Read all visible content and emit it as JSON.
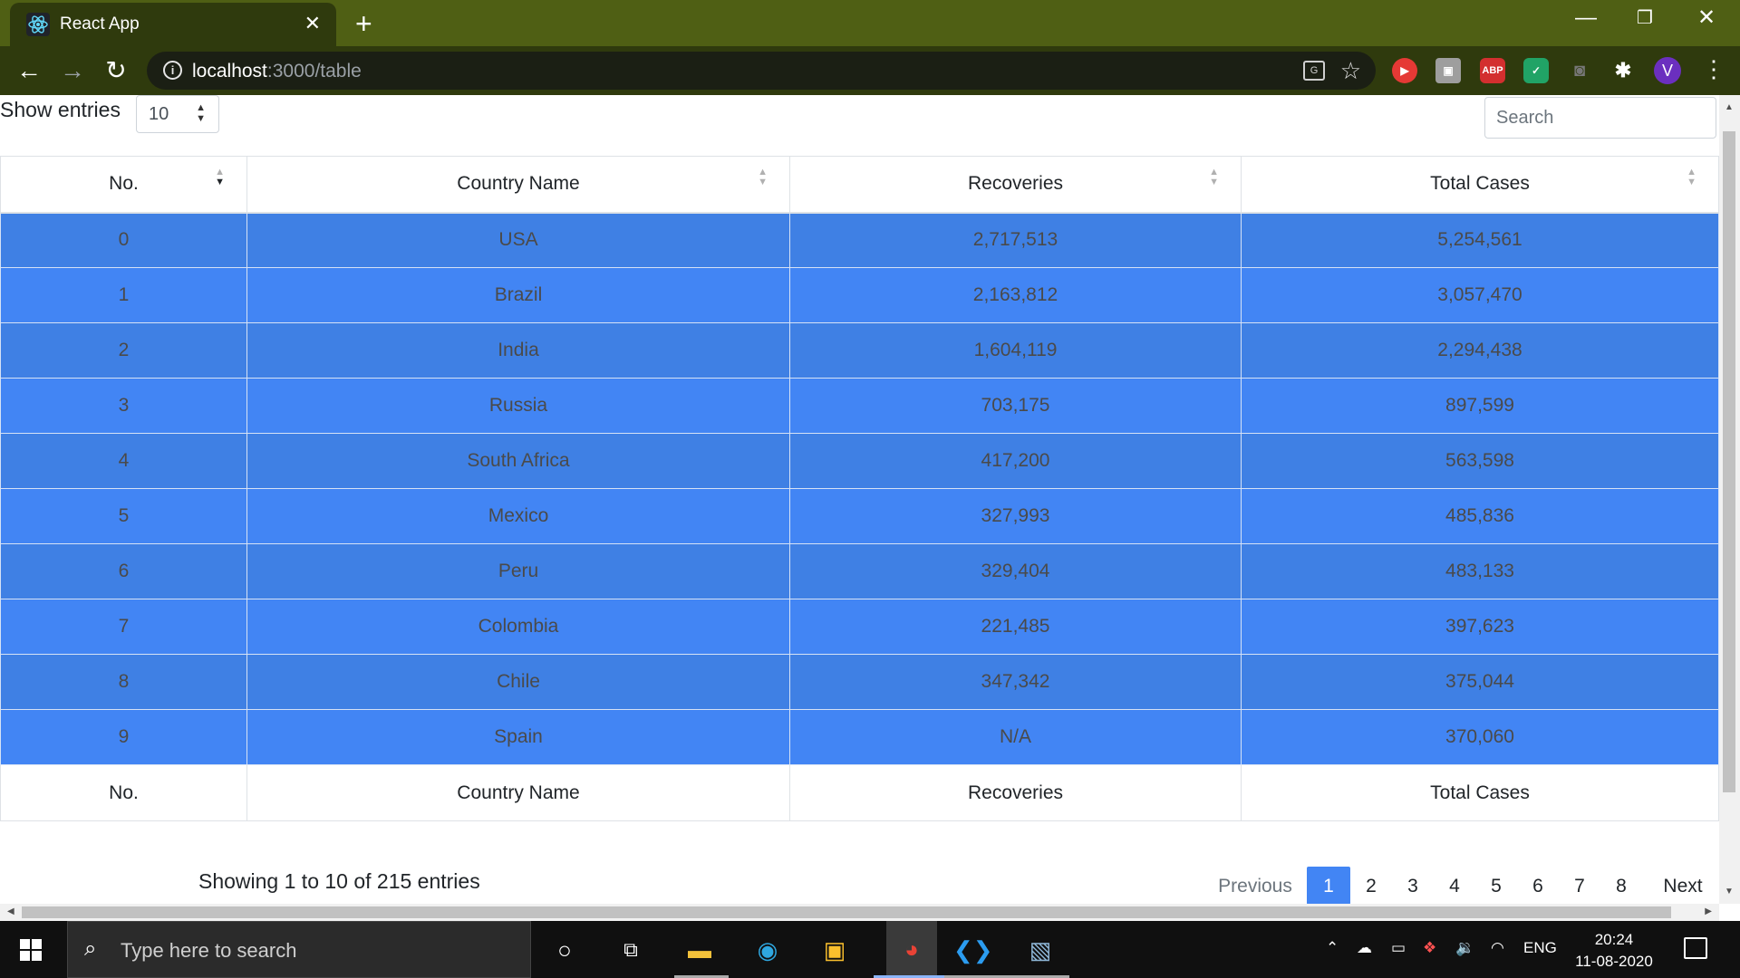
{
  "browser": {
    "tab_title": "React App",
    "url_host": "localhost",
    "url_rest": ":3000/table",
    "extensions": [
      "youtube-ext",
      "ext-grey",
      "ABP",
      "check-ext",
      "camera-ext",
      "puzzle-ext"
    ],
    "abp_label": "ABP",
    "profile_initial": "V"
  },
  "page": {
    "show_entries_label": "Show entries",
    "entries_value": "10",
    "search_placeholder": "Search",
    "columns": [
      "No.",
      "Country Name",
      "Recoveries",
      "Total Cases"
    ],
    "rows": [
      [
        "0",
        "USA",
        "2,717,513",
        "5,254,561"
      ],
      [
        "1",
        "Brazil",
        "2,163,812",
        "3,057,470"
      ],
      [
        "2",
        "India",
        "1,604,119",
        "2,294,438"
      ],
      [
        "3",
        "Russia",
        "703,175",
        "897,599"
      ],
      [
        "4",
        "South Africa",
        "417,200",
        "563,598"
      ],
      [
        "5",
        "Mexico",
        "327,993",
        "485,836"
      ],
      [
        "6",
        "Peru",
        "329,404",
        "483,133"
      ],
      [
        "7",
        "Colombia",
        "221,485",
        "397,623"
      ],
      [
        "8",
        "Chile",
        "347,342",
        "375,044"
      ],
      [
        "9",
        "Spain",
        "N/A",
        "370,060"
      ]
    ],
    "info_text": "Showing 1 to 10 of 215 entries",
    "pagination": {
      "previous": "Previous",
      "pages": [
        "1",
        "2",
        "3",
        "4",
        "5",
        "6",
        "7",
        "8"
      ],
      "active": "1",
      "next": "Next"
    },
    "row_color_odd": "#3f80e4",
    "row_color_even": "#4285f4"
  },
  "taskbar": {
    "search_placeholder": "Type here to search",
    "language": "ENG",
    "time": "20:24",
    "date": "11-08-2020"
  }
}
